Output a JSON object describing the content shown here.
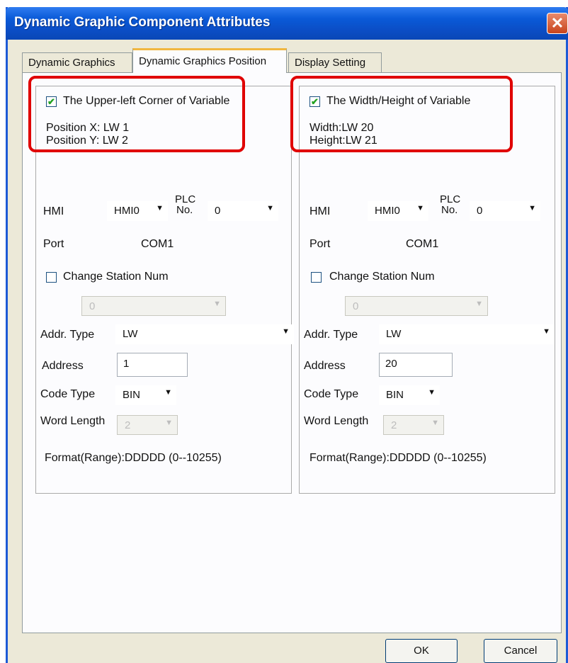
{
  "window": {
    "title": "Dynamic Graphic Component Attributes",
    "close_symbol": "✕"
  },
  "tabs": [
    {
      "label": "Dynamic Graphics"
    },
    {
      "label": "Dynamic Graphics Position"
    },
    {
      "label": "Display Setting"
    }
  ],
  "left_group": {
    "checkbox_label": "The Upper-left Corner of Variable",
    "checked": true,
    "line1": "Position X: LW 1",
    "line2": "Position Y: LW 2",
    "hmi_label": "HMI",
    "hmi_value": "HMI0",
    "plc_label_1": "PLC",
    "plc_label_2": "No.",
    "plc_value": "0",
    "port_label": "Port",
    "port_value": "COM1",
    "change_station_label": "Change Station Num",
    "station_value": "0",
    "addr_type_label": "Addr. Type",
    "addr_type_value": "LW",
    "address_label": "Address",
    "address_value": "1",
    "code_type_label": "Code Type",
    "code_type_value": "BIN",
    "word_length_label": "Word Length",
    "word_length_value": "2",
    "format": "Format(Range):DDDDD (0--10255)"
  },
  "right_group": {
    "checkbox_label": "The Width/Height of Variable",
    "checked": true,
    "line1": "Width:LW 20",
    "line2": "Height:LW 21",
    "hmi_label": "HMI",
    "hmi_value": "HMI0",
    "plc_label_1": "PLC",
    "plc_label_2": "No.",
    "plc_value": "0",
    "port_label": "Port",
    "port_value": "COM1",
    "change_station_label": "Change Station Num",
    "station_value": "0",
    "addr_type_label": "Addr. Type",
    "addr_type_value": "LW",
    "address_label": "Address",
    "address_value": "20",
    "code_type_label": "Code Type",
    "code_type_value": "BIN",
    "word_length_label": "Word Length",
    "word_length_value": "2",
    "format": "Format(Range):DDDDD (0--10255)"
  },
  "buttons": {
    "ok": "OK",
    "cancel": "Cancel"
  },
  "icons": {
    "checkmark": "✔",
    "dropdown": "▼"
  },
  "colors": {
    "titlebar": "#0a5ad8",
    "highlight": "#e00000",
    "active_tab_accent": "#f1b740"
  }
}
